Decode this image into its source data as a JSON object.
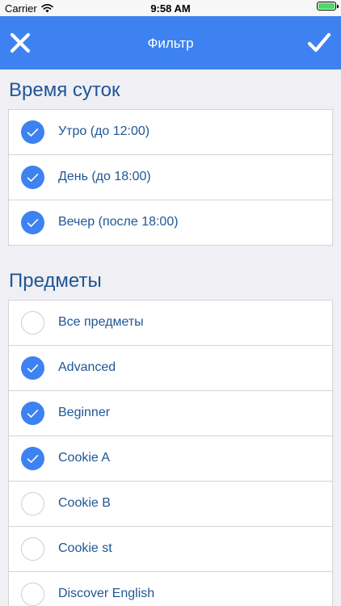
{
  "status_bar": {
    "carrier": "Carrier",
    "time": "9:58 AM"
  },
  "nav": {
    "title": "Фильтр",
    "close_icon": "close-x-icon",
    "confirm_icon": "checkmark-icon"
  },
  "colors": {
    "accent": "#3d82f0",
    "section_text": "#1e5696",
    "background": "#efeff4"
  },
  "time_of_day": {
    "title": "Время суток",
    "items": [
      {
        "label": "Утро (до 12:00)",
        "checked": true
      },
      {
        "label": "День (до 18:00)",
        "checked": true
      },
      {
        "label": "Вечер (после 18:00)",
        "checked": true
      }
    ]
  },
  "subjects": {
    "title": "Предметы",
    "items": [
      {
        "label": "Все предметы",
        "checked": false
      },
      {
        "label": "Advanced",
        "checked": true
      },
      {
        "label": "Beginner",
        "checked": true
      },
      {
        "label": "Cookie A",
        "checked": true
      },
      {
        "label": "Cookie B",
        "checked": false
      },
      {
        "label": "Cookie st",
        "checked": false
      },
      {
        "label": "Discover English",
        "checked": false
      }
    ]
  }
}
